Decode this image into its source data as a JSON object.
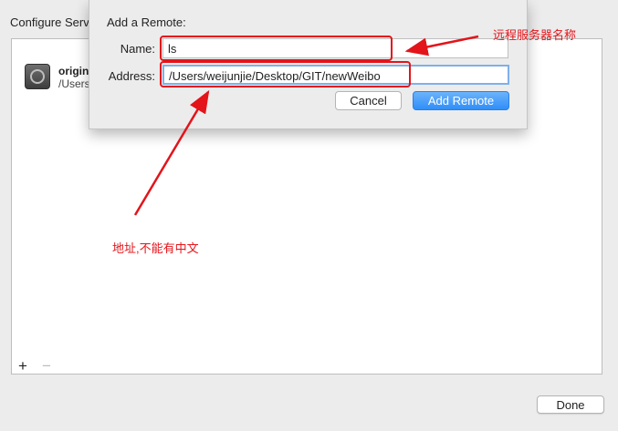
{
  "background": {
    "title": "Configure Serv",
    "remote": {
      "name": "origin",
      "path": "/Users"
    },
    "add_label": "+",
    "remove_label": "−",
    "done_label": "Done"
  },
  "dialog": {
    "title": "Add a Remote:",
    "name_label": "Name:",
    "name_value": "ls",
    "address_label": "Address:",
    "address_value": "/Users/weijunjie/Desktop/GIT/newWeibo",
    "cancel_label": "Cancel",
    "add_label": "Add Remote"
  },
  "annotations": {
    "server_name": "远程服务器名称",
    "address_note": "地址,不能有中文",
    "color": "#e3141a"
  },
  "colors": {
    "accent": "#2f8ef9",
    "focus_ring": "#7fb0ea"
  }
}
